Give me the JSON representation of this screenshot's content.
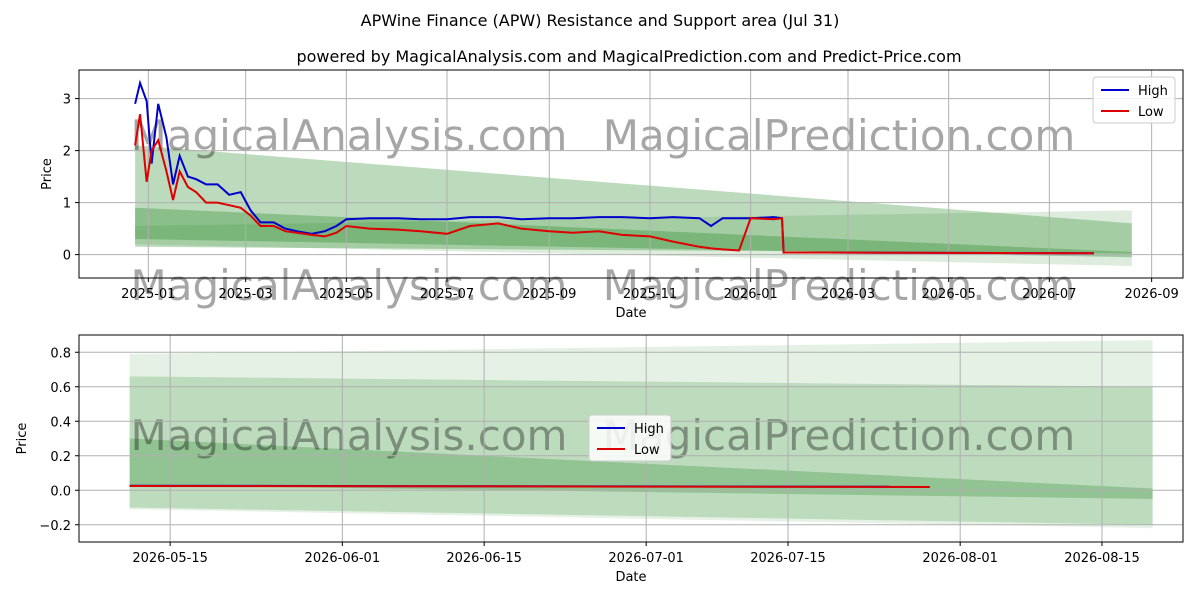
{
  "title": "APWine Finance (APW) Resistance and Support area (Jul 31)",
  "subtitle": "powered by MagicalAnalysis.com and MagicalPrediction.com and Predict-Price.com",
  "watermarks": [
    "MagicalAnalysis.com",
    "MagicalPrediction.com"
  ],
  "colors": {
    "high": "#0000cc",
    "low": "#dd0000",
    "band": "#2e8b2e",
    "grid": "#b0b0b0"
  },
  "chart_data": [
    {
      "type": "line",
      "xlabel": "Date",
      "ylabel": "Price",
      "x_ticks": [
        "2025-01",
        "2025-03",
        "2025-05",
        "2025-07",
        "2025-09",
        "2025-11",
        "2026-01",
        "2026-03",
        "2026-05",
        "2026-07",
        "2026-09"
      ],
      "y_ticks": [
        "0",
        "1",
        "2",
        "3"
      ],
      "xlim": [
        "2024-11-20",
        "2026-09-20"
      ],
      "ylim": [
        -0.45,
        3.55
      ],
      "grid": true,
      "legend": "top-right",
      "series": [
        {
          "name": "High",
          "x": [
            "2024-12-24",
            "2024-12-27",
            "2024-12-31",
            "2025-01-03",
            "2025-01-07",
            "2025-01-12",
            "2025-01-16",
            "2025-01-20",
            "2025-01-25",
            "2025-01-30",
            "2025-02-05",
            "2025-02-12",
            "2025-02-19",
            "2025-02-26",
            "2025-03-04",
            "2025-03-10",
            "2025-03-18",
            "2025-03-25",
            "2025-04-01",
            "2025-04-10",
            "2025-04-18",
            "2025-04-25",
            "2025-05-01",
            "2025-05-15",
            "2025-06-01",
            "2025-06-15",
            "2025-07-01",
            "2025-07-15",
            "2025-08-01",
            "2025-08-15",
            "2025-09-01",
            "2025-09-15",
            "2025-10-01",
            "2025-10-15",
            "2025-11-01",
            "2025-11-15",
            "2025-12-01",
            "2025-12-08",
            "2025-12-15",
            "2026-01-01",
            "2026-01-15",
            "2026-01-20",
            "2026-01-21",
            "2026-02-15",
            "2026-04-01",
            "2026-06-01",
            "2026-07-28"
          ],
          "values": [
            2.9,
            3.3,
            2.95,
            1.75,
            2.9,
            2.25,
            1.35,
            1.9,
            1.5,
            1.45,
            1.35,
            1.35,
            1.15,
            1.2,
            0.85,
            0.62,
            0.62,
            0.5,
            0.45,
            0.4,
            0.45,
            0.55,
            0.68,
            0.7,
            0.7,
            0.68,
            0.68,
            0.72,
            0.72,
            0.68,
            0.7,
            0.7,
            0.72,
            0.72,
            0.7,
            0.72,
            0.7,
            0.55,
            0.7,
            0.7,
            0.72,
            0.7,
            0.04,
            0.04,
            0.035,
            0.03,
            0.025
          ]
        },
        {
          "name": "Low",
          "x": [
            "2024-12-24",
            "2024-12-27",
            "2024-12-31",
            "2025-01-03",
            "2025-01-07",
            "2025-01-12",
            "2025-01-16",
            "2025-01-20",
            "2025-01-25",
            "2025-01-30",
            "2025-02-05",
            "2025-02-12",
            "2025-02-19",
            "2025-02-26",
            "2025-03-04",
            "2025-03-10",
            "2025-03-18",
            "2025-03-25",
            "2025-04-01",
            "2025-04-10",
            "2025-04-18",
            "2025-04-25",
            "2025-05-01",
            "2025-05-15",
            "2025-06-01",
            "2025-06-15",
            "2025-07-01",
            "2025-07-15",
            "2025-08-01",
            "2025-08-15",
            "2025-09-01",
            "2025-09-15",
            "2025-10-01",
            "2025-10-15",
            "2025-11-01",
            "2025-11-15",
            "2025-12-01",
            "2025-12-08",
            "2025-12-15",
            "2025-12-25",
            "2026-01-01",
            "2026-01-15",
            "2026-01-20",
            "2026-01-21",
            "2026-02-15",
            "2026-04-01",
            "2026-06-01",
            "2026-07-28"
          ],
          "values": [
            2.1,
            2.7,
            1.4,
            2.0,
            2.2,
            1.6,
            1.05,
            1.6,
            1.3,
            1.2,
            1.0,
            1.0,
            0.95,
            0.9,
            0.75,
            0.55,
            0.55,
            0.45,
            0.42,
            0.38,
            0.35,
            0.42,
            0.55,
            0.5,
            0.48,
            0.45,
            0.4,
            0.55,
            0.6,
            0.5,
            0.45,
            0.42,
            0.45,
            0.38,
            0.35,
            0.25,
            0.15,
            0.12,
            0.1,
            0.08,
            0.7,
            0.68,
            0.7,
            0.04,
            0.04,
            0.035,
            0.03,
            0.025
          ]
        }
      ],
      "bands": [
        {
          "x": [
            "2024-12-24",
            "2026-08-20"
          ],
          "upper": [
            2.1,
            0.6
          ],
          "lower": [
            0.15,
            0.02
          ]
        },
        {
          "x": [
            "2024-12-24",
            "2026-08-20"
          ],
          "upper": [
            0.9,
            0.05
          ],
          "lower": [
            0.3,
            -0.05
          ]
        },
        {
          "x": [
            "2024-12-24",
            "2026-08-20"
          ],
          "upper": [
            0.55,
            0.85
          ],
          "lower": [
            0.2,
            -0.22
          ]
        }
      ]
    },
    {
      "type": "line",
      "xlabel": "Date",
      "ylabel": "Price",
      "x_ticks": [
        "2026-05-15",
        "2026-06-01",
        "2026-06-15",
        "2026-07-01",
        "2026-07-15",
        "2026-08-01",
        "2026-08-15"
      ],
      "y_ticks": [
        "−0.2",
        "0.0",
        "0.2",
        "0.4",
        "0.6",
        "0.8"
      ],
      "xlim": [
        "2026-05-06",
        "2026-08-23"
      ],
      "ylim": [
        -0.3,
        0.9
      ],
      "grid": true,
      "legend": "center",
      "series": [
        {
          "name": "High",
          "x": [
            "2026-05-11",
            "2026-07-29"
          ],
          "values": [
            0.026,
            0.02
          ]
        },
        {
          "name": "Low",
          "x": [
            "2026-05-11",
            "2026-07-29"
          ],
          "values": [
            0.025,
            0.019
          ]
        }
      ],
      "bands": [
        {
          "x": [
            "2026-05-11",
            "2026-08-20"
          ],
          "upper": [
            0.79,
            0.87
          ],
          "lower": [
            -0.11,
            -0.22
          ]
        },
        {
          "x": [
            "2026-05-11",
            "2026-08-20"
          ],
          "upper": [
            0.66,
            0.6
          ],
          "lower": [
            -0.1,
            -0.2
          ]
        },
        {
          "x": [
            "2026-05-11",
            "2026-08-20"
          ],
          "upper": [
            0.3,
            0.01
          ],
          "lower": [
            0.03,
            -0.05
          ]
        }
      ]
    }
  ]
}
